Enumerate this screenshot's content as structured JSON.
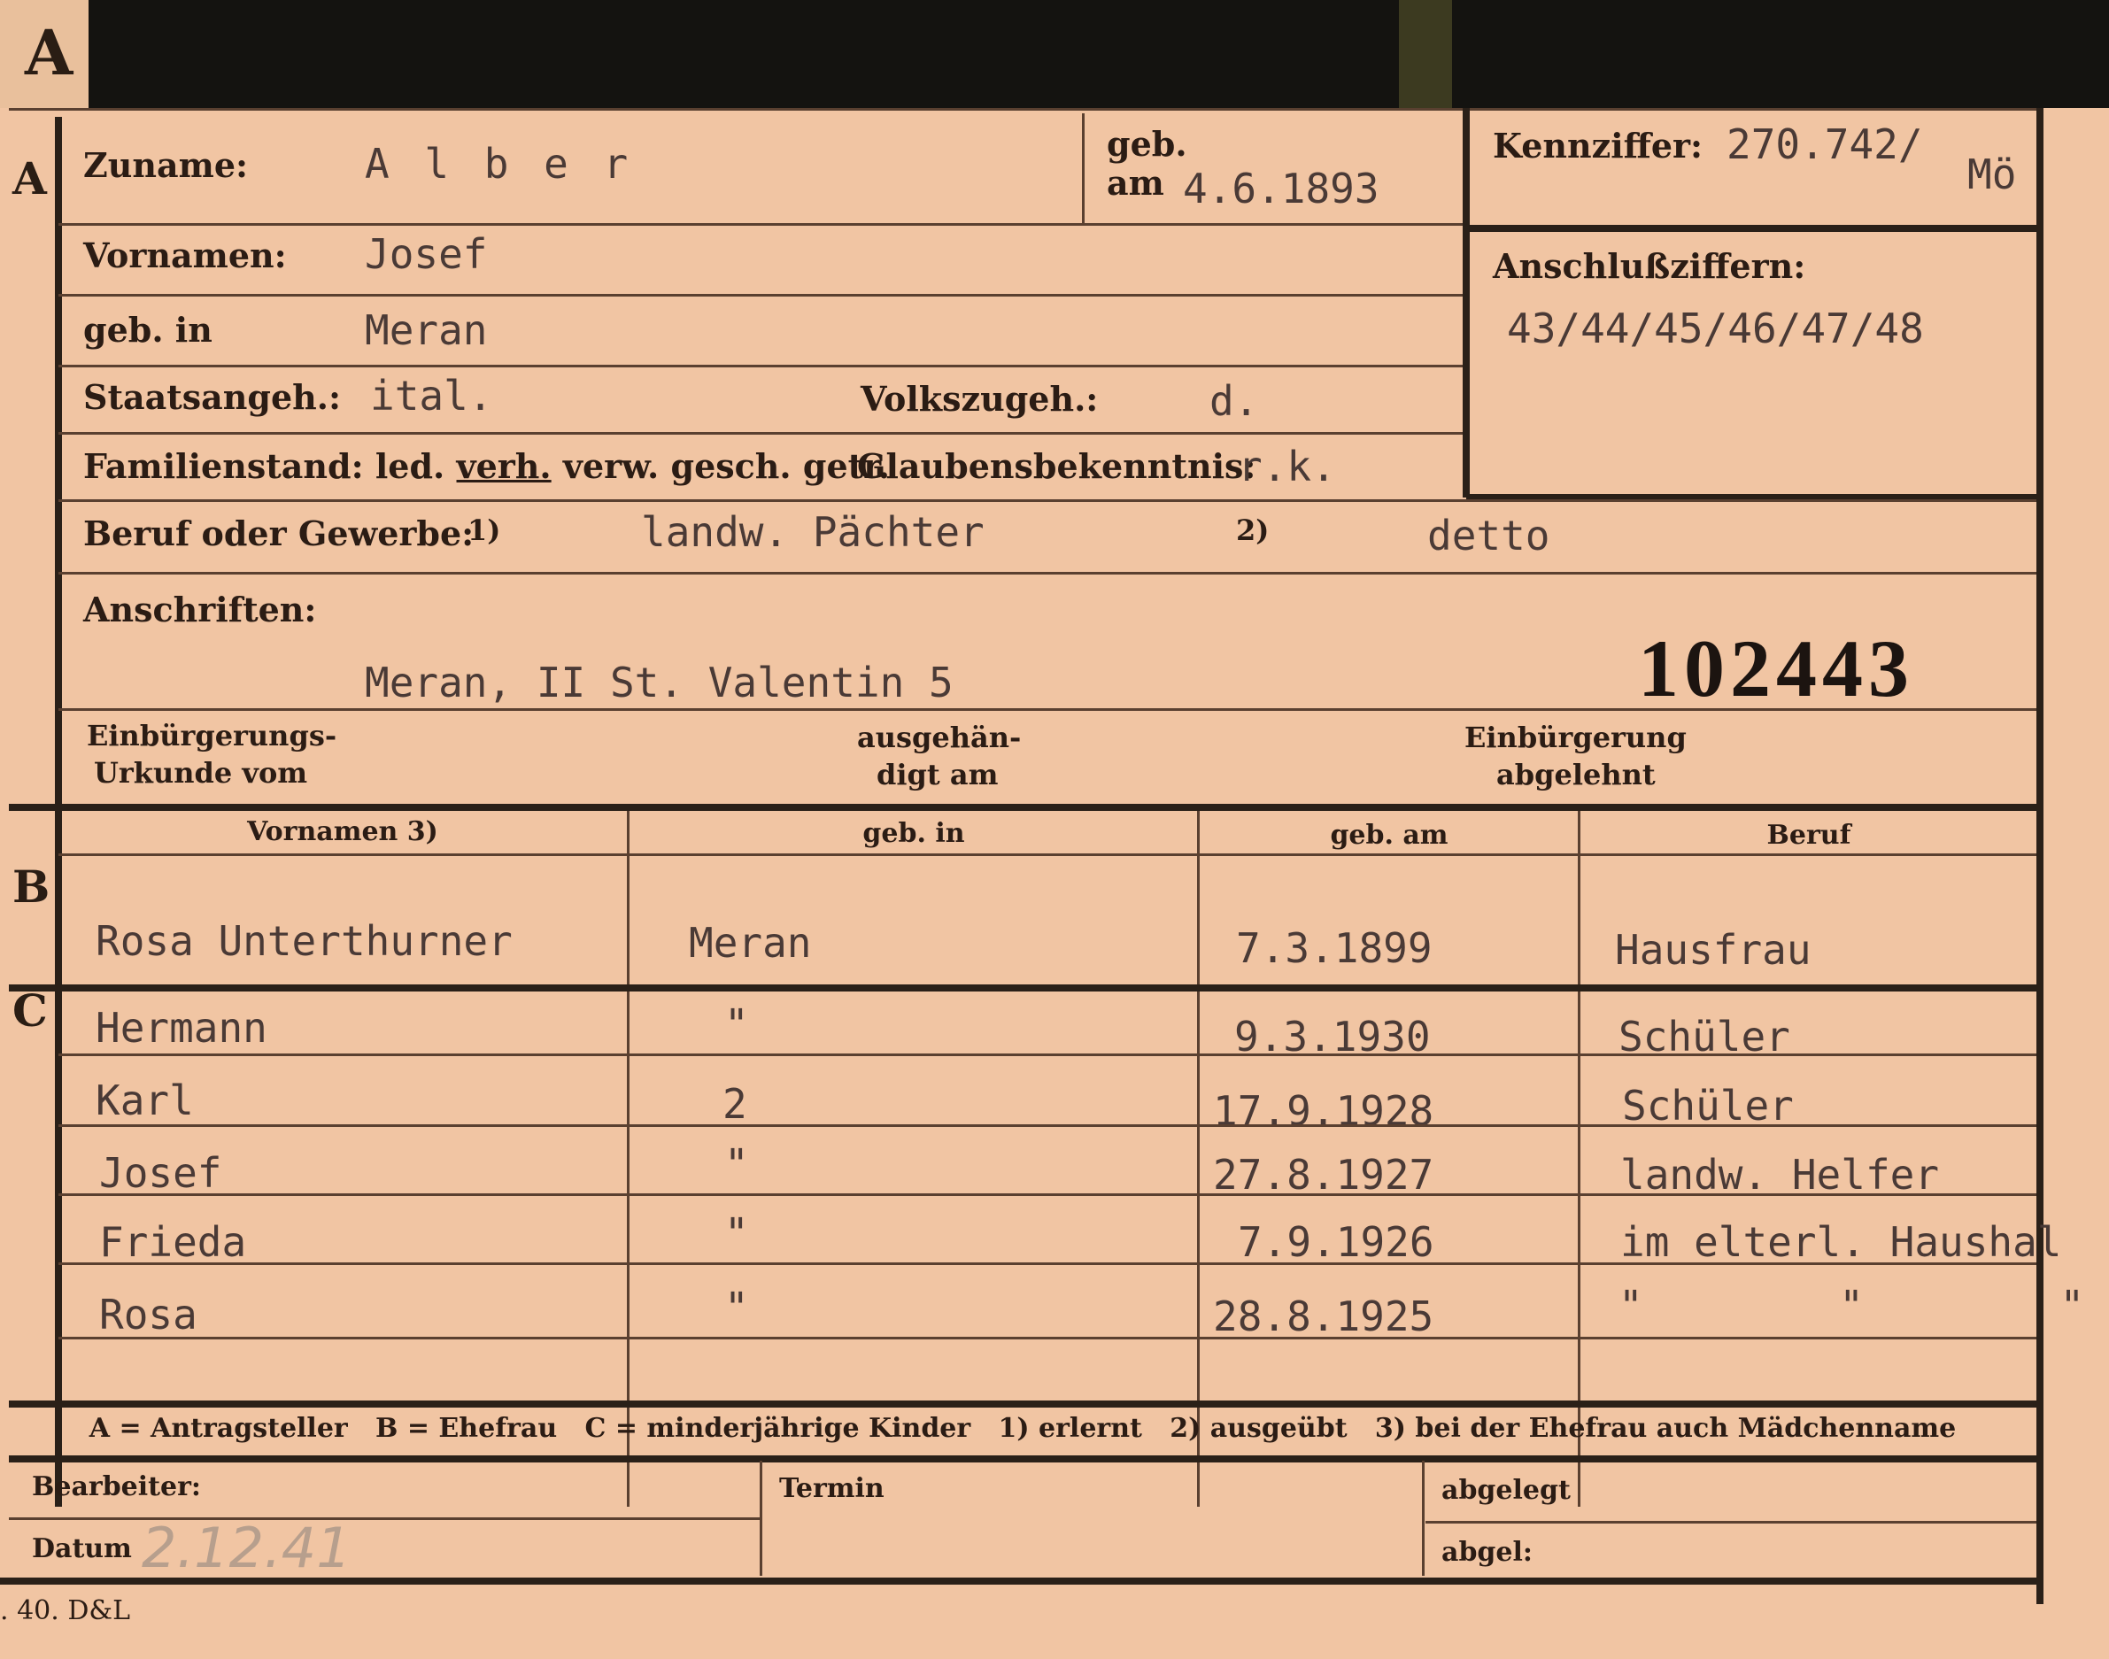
{
  "corner_letter": "A",
  "section_letters": {
    "a": "A",
    "b": "B",
    "c": "C"
  },
  "fields": {
    "zuname_label": "Zuname:",
    "zuname_value": "A l b e r",
    "geb_label": "geb.",
    "am_label": "am",
    "geb_am_value": "4.6.1893",
    "kennziffer_label": "Kennziffer:",
    "kennziffer_value": "270.742/",
    "kennziffer_suffix": "Mö",
    "vornamen_label": "Vornamen:",
    "vornamen_value": "Josef",
    "anschluss_label": "Anschlußziffern:",
    "anschluss_value": "43/44/45/46/47/48",
    "geb_in_label": "geb. in",
    "geb_in_value": "Meran",
    "staat_label": "Staatsangeh.:",
    "staat_value": "ital.",
    "volks_label": "Volkszugeh.:",
    "volks_value": "d.",
    "familienstand_label": "Familienstand: led.",
    "familienstand_verh": "verh.",
    "familienstand_rest": "verw. gesch. getr.",
    "glauben_label": "Glaubensbekenntnis:",
    "glauben_value": "r.k.",
    "beruf_label": "Beruf oder Gewerbe:",
    "beruf_mark1": "1)",
    "beruf_value1": "landw. Pächter",
    "beruf_mark2": "2)",
    "beruf_value2": "detto",
    "anschriften_label": "Anschriften:",
    "anschriften_value": "Meran, II St. Valentin 5",
    "card_number": "102443",
    "einb_urkunde_1": "Einbürgerungs-",
    "einb_urkunde_2": "Urkunde vom",
    "ausgehaendigt_1": "ausgehän-",
    "ausgehaendigt_2": "digt am",
    "einb_abgelehnt_1": "Einbürgerung",
    "einb_abgelehnt_2": "abgelehnt"
  },
  "table_headers": [
    "Vornamen 3)",
    "geb. in",
    "geb. am",
    "Beruf"
  ],
  "ehefrau": {
    "vorname": "Rosa Unterthurner",
    "geb_in": "Meran",
    "geb_am": "7.3.1899",
    "beruf": "Hausfrau"
  },
  "kinder": [
    {
      "vorname": "Hermann",
      "geb_in": "\"",
      "geb_am": "9.3.1930",
      "beruf": "Schüler"
    },
    {
      "vorname": "Karl",
      "geb_in": "2",
      "geb_am": "17.9.1928",
      "beruf": "Schüler"
    },
    {
      "vorname": "Josef",
      "geb_in": "\"",
      "geb_am": "27.8.1927",
      "beruf": "landw. Helfer"
    },
    {
      "vorname": "Frieda",
      "geb_in": "\"",
      "geb_am": "7.9.1926",
      "beruf": "im elterl. Haushal"
    },
    {
      "vorname": "Rosa",
      "geb_in": "\"",
      "geb_am": "28.8.1925",
      "beruf": "\"        \"        \""
    }
  ],
  "legend": "A = Antragsteller   B = Ehefrau   C = minderjährige Kinder   1) erlernt   2) ausgeübt   3) bei der Ehefrau auch Mädchenname",
  "footer": {
    "bearbeiter_label": "Bearbeiter:",
    "datum_label": "Datum",
    "datum_value": "2.12.41",
    "termin_label": "Termin",
    "abgelegt_label": "abgelegt",
    "abgel2_label": "abgel:"
  },
  "print_note": ". 40. D&L"
}
